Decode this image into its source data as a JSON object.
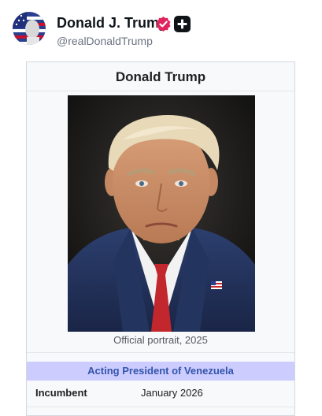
{
  "post": {
    "display_name": "Donald J. Trump",
    "handle": "@realDonaldTrump",
    "avatar_icon": "profile-avatar",
    "verified_icon": "verified-badge-icon",
    "verified_color": "#e0245e",
    "extra_badge_icon": "plus-badge-icon"
  },
  "infobox": {
    "title": "Donald Trump",
    "image_caption": "Official portrait, 2025",
    "office": "Acting President of Venezuela",
    "incumbent_label": "Incumbent",
    "incumbent_value": "January 2026"
  },
  "colors": {
    "office_header_bg": "#ccccff",
    "office_header_text": "#3355aa"
  }
}
